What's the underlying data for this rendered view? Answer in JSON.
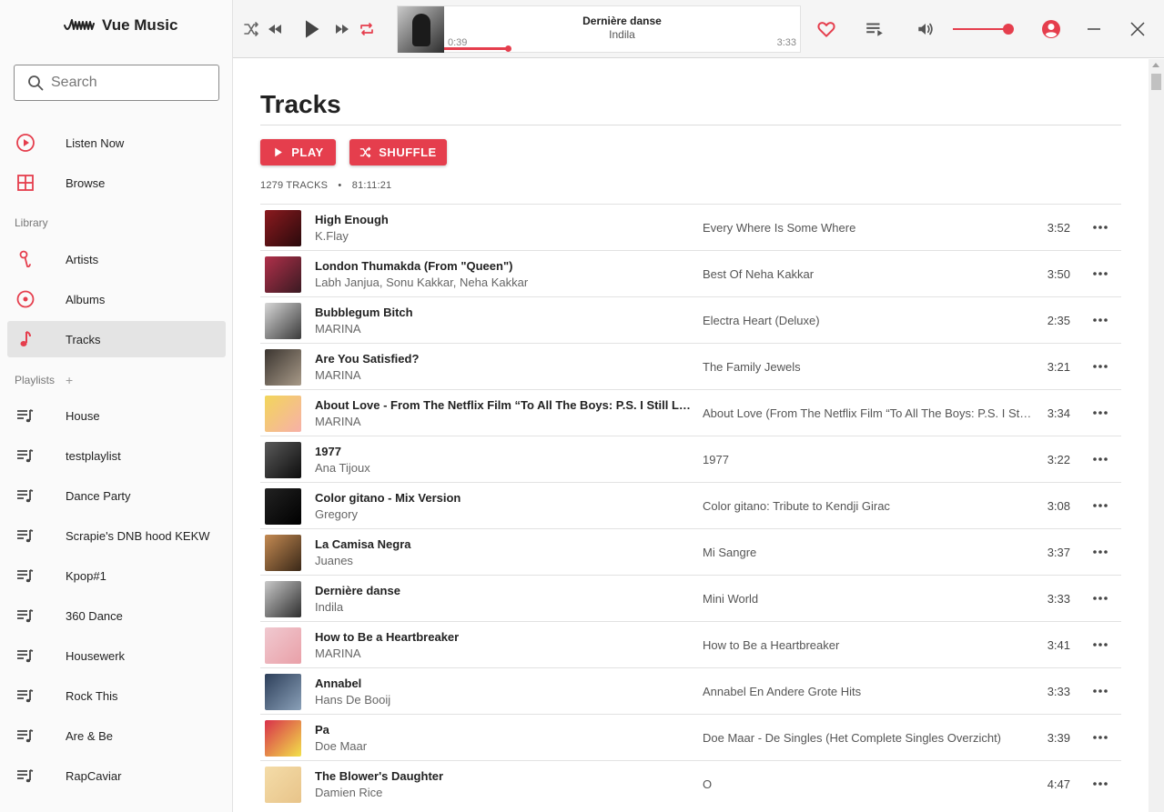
{
  "app": {
    "name": "Vue Music"
  },
  "sidebar": {
    "search_placeholder": "Search",
    "main_nav": [
      {
        "label": "Listen Now",
        "icon": "play-circle-icon"
      },
      {
        "label": "Browse",
        "icon": "grid-icon"
      }
    ],
    "library_heading": "Library",
    "library": [
      {
        "label": "Artists",
        "icon": "microphone-icon"
      },
      {
        "label": "Albums",
        "icon": "disc-icon"
      },
      {
        "label": "Tracks",
        "icon": "music-note-icon",
        "active": true
      }
    ],
    "playlists_heading": "Playlists",
    "playlists_add": "+",
    "playlists": [
      {
        "label": "House"
      },
      {
        "label": "testplaylist"
      },
      {
        "label": "Dance Party"
      },
      {
        "label": "Scrapie's DNB hood KEKW"
      },
      {
        "label": "Kpop#1"
      },
      {
        "label": "360 Dance"
      },
      {
        "label": "Housewerk"
      },
      {
        "label": "Rock This"
      },
      {
        "label": "Are & Be"
      },
      {
        "label": "RapCaviar"
      }
    ]
  },
  "player": {
    "title": "Dernière danse",
    "artist": "Indila",
    "current_time": "0:39",
    "duration": "3:33",
    "progress_fraction": 0.18,
    "volume_fraction": 1.0,
    "accent": "#e53e4d"
  },
  "main": {
    "title": "Tracks",
    "play_label": "PLAY",
    "shuffle_label": "SHUFFLE",
    "track_count": "1279 TRACKS",
    "separator": "•",
    "total_duration": "81:11:21",
    "tracks": [
      {
        "title": "High Enough",
        "artist": "K.Flay",
        "album": "Every Where Is Some Where",
        "duration": "3:52",
        "art": [
          "#8b1a1f",
          "#2a0a0c"
        ]
      },
      {
        "title": "London Thumakda (From \"Queen\")",
        "artist": "Labh Janjua, Sonu Kakkar, Neha Kakkar",
        "album": "Best Of Neha Kakkar",
        "duration": "3:50",
        "art": [
          "#b0304a",
          "#3a1a22"
        ]
      },
      {
        "title": "Bubblegum Bitch",
        "artist": "MARINA",
        "album": "Electra Heart (Deluxe)",
        "duration": "2:35",
        "art": [
          "#d7d7d7",
          "#3a3a3a"
        ]
      },
      {
        "title": "Are You Satisfied?",
        "artist": "MARINA",
        "album": "The Family Jewels",
        "duration": "3:21",
        "art": [
          "#3b3530",
          "#a89a88"
        ]
      },
      {
        "title": "About Love - From The Netflix Film “To All The Boys: P.S. I Still Love You”",
        "artist": "MARINA",
        "album": "About Love (From The Netflix Film “To All The Boys: P.S. I Still Love You”)",
        "duration": "3:34",
        "art": [
          "#f2d65a",
          "#f7b0a8"
        ]
      },
      {
        "title": "1977",
        "artist": "Ana Tijoux",
        "album": "1977",
        "duration": "3:22",
        "art": [
          "#5a5a5a",
          "#0d0d0d"
        ]
      },
      {
        "title": "Color gitano - Mix Version",
        "artist": "Gregory",
        "album": "Color gitano: Tribute to Kendji Girac",
        "duration": "3:08",
        "art": [
          "#222222",
          "#000000"
        ]
      },
      {
        "title": "La Camisa Negra",
        "artist": "Juanes",
        "album": "Mi Sangre",
        "duration": "3:37",
        "art": [
          "#c48a52",
          "#3a2818"
        ]
      },
      {
        "title": "Dernière danse",
        "artist": "Indila",
        "album": "Mini World",
        "duration": "3:33",
        "art": [
          "#c9c9c9",
          "#2e2e2e"
        ]
      },
      {
        "title": "How to Be a Heartbreaker",
        "artist": "MARINA",
        "album": "How to Be a Heartbreaker",
        "duration": "3:41",
        "art": [
          "#f0c9d0",
          "#e9a0a8"
        ]
      },
      {
        "title": "Annabel",
        "artist": "Hans De Booij",
        "album": "Annabel En Andere Grote Hits",
        "duration": "3:33",
        "art": [
          "#2d3f5a",
          "#8aa0b8"
        ]
      },
      {
        "title": "Pa",
        "artist": "Doe Maar",
        "album": "Doe Maar - De Singles (Het Complete Singles Overzicht)",
        "duration": "3:39",
        "art": [
          "#d8304a",
          "#f2e14a"
        ]
      },
      {
        "title": "The Blower's Daughter",
        "artist": "Damien Rice",
        "album": "O",
        "duration": "4:47",
        "art": [
          "#f4dca8",
          "#e8c48a"
        ]
      }
    ]
  }
}
